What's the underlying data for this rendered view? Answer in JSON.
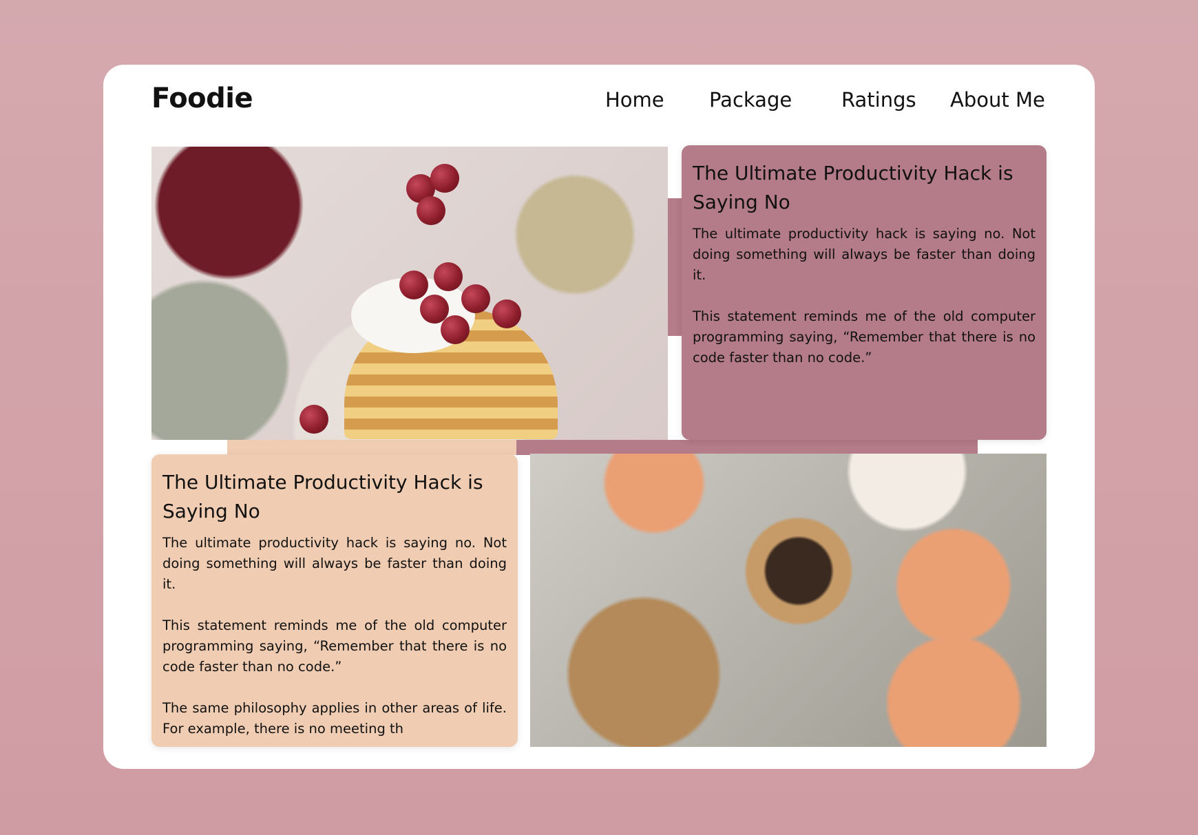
{
  "header": {
    "logo": "Foodie",
    "nav": [
      {
        "label": "Home"
      },
      {
        "label": "Package"
      },
      {
        "label": "Ratings"
      },
      {
        "label": "About Me"
      }
    ]
  },
  "sections": [
    {
      "title": "The Ultimate Productivity Hack is Saying No",
      "paragraphs": [
        "The ultimate productivity hack is saying no. Not doing something will always be faster than doing it.",
        "This statement reminds me of the old computer programming saying, “Remember that there is no code faster than no code.”"
      ],
      "color": "#b47b88",
      "image": "pancakes-with-cherries-photo"
    },
    {
      "title": "The Ultimate Productivity Hack is Saying No",
      "paragraphs": [
        "The ultimate productivity hack is saying no. Not doing something will always be faster than doing it.",
        "This statement reminds me of the old computer programming saying, “Remember that there is no code faster than no code.”",
        "The same philosophy applies in other areas of life. For example, there is no meeting th"
      ],
      "color": "#f0cdb2",
      "image": "bread-nuts-oranges-eggs-photo"
    }
  ]
}
